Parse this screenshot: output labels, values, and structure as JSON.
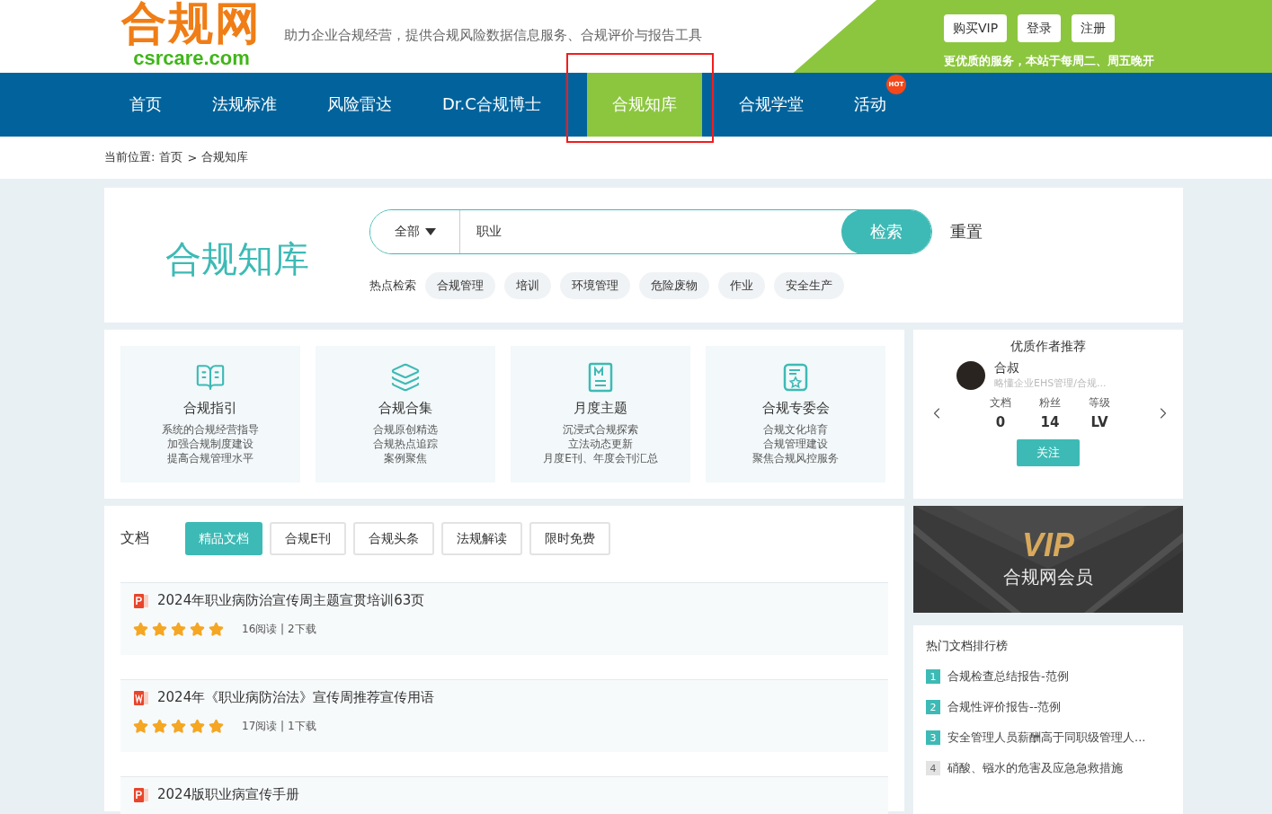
{
  "header": {
    "logo_text": "合规网",
    "logo_domain": "csrcare.com",
    "slogan": "助力企业合规经营，提供合规风险数据信息服务、合规评价与报告工具",
    "buttons": [
      "购买VIP",
      "登录",
      "注册"
    ],
    "notice": "更优质的服务，本站于每周二、周五晚开"
  },
  "nav": [
    {
      "label": "首页",
      "selected": false,
      "highlighted": false
    },
    {
      "label": "法规标准",
      "selected": false,
      "highlighted": false
    },
    {
      "label": "风险雷达",
      "selected": false,
      "highlighted": false
    },
    {
      "label": "Dr.C合规博士",
      "selected": false,
      "highlighted": false
    },
    {
      "label": "合规知库",
      "selected": true,
      "highlighted": true
    },
    {
      "label": "合规学堂",
      "selected": false,
      "highlighted": false
    },
    {
      "label": "活动",
      "selected": false,
      "highlighted": false,
      "badge": "HOT"
    }
  ],
  "breadcrumb": {
    "label": "当前位置:",
    "items": [
      "首页",
      "合规知库"
    ],
    "separator": ">"
  },
  "search": {
    "title": "合规知库",
    "scope": "全部",
    "value": "职业",
    "button": "检索",
    "reset": "重置",
    "hot_label": "热点检索",
    "hot_tags": [
      "合规管理",
      "培训",
      "环境管理",
      "危险废物",
      "作业",
      "安全生产"
    ]
  },
  "categories": [
    {
      "kind": "book",
      "title": "合规指引",
      "lines": [
        "系统的合规经营指导",
        "加强合规制度建设",
        "提高合规管理水平"
      ]
    },
    {
      "kind": "layers",
      "title": "合规合集",
      "lines": [
        "合规原创精选",
        "合规热点追踪",
        "案例聚焦"
      ]
    },
    {
      "kind": "document",
      "title": "月度主题",
      "lines": [
        "沉浸式合规探索",
        "立法动态更新",
        "月度E刊、年度会刊汇总"
      ]
    },
    {
      "kind": "award",
      "title": "合规专委会",
      "lines": [
        "合规文化培育",
        "合规管理建设",
        "聚焦合规风控服务"
      ]
    }
  ],
  "author_panel": {
    "title": "优质作者推荐",
    "name": "合叔",
    "bio": "略懂企业EHS管理/合规...",
    "stats": [
      {
        "label": "文档",
        "value": "0"
      },
      {
        "label": "粉丝",
        "value": "14"
      },
      {
        "label": "等级",
        "value": "LV"
      }
    ],
    "follow": "关注"
  },
  "docs": {
    "label": "文档",
    "tabs": [
      {
        "label": "精品文档",
        "selected": true
      },
      {
        "label": "合规E刊",
        "selected": false
      },
      {
        "label": "合规头条",
        "selected": false
      },
      {
        "label": "法规解读",
        "selected": false
      },
      {
        "label": "限时免费",
        "selected": false
      }
    ],
    "separator": "|",
    "items": [
      {
        "kind": "ppt",
        "title": "2024年职业病防治宣传周主题宣贯培训63页",
        "stars": 5,
        "reads": "16阅读",
        "downloads": "2下载"
      },
      {
        "kind": "word",
        "title": "2024年《职业病防治法》宣传周推荐宣传用语",
        "stars": 5,
        "reads": "17阅读",
        "downloads": "1下载"
      },
      {
        "kind": "ppt",
        "title": "2024版职业病宣传手册"
      }
    ]
  },
  "vip_banner": {
    "kind": "picture",
    "logo": "VIP",
    "caption": "合规网会员"
  },
  "ranking": {
    "title": "热门文档排行榜",
    "items": [
      {
        "rank": "1",
        "title": "合规检查总结报告-范例",
        "color": "#3dbab5"
      },
      {
        "rank": "2",
        "title": "合规性评价报告--范例",
        "color": "#3dbab5"
      },
      {
        "rank": "3",
        "title": "安全管理人员薪酬高于同职级管理人...",
        "color": "#3dbab5"
      },
      {
        "rank": "4",
        "title": "硝酸、镪水的危害及应急急救措施",
        "color": "#e3e3e3"
      }
    ]
  }
}
